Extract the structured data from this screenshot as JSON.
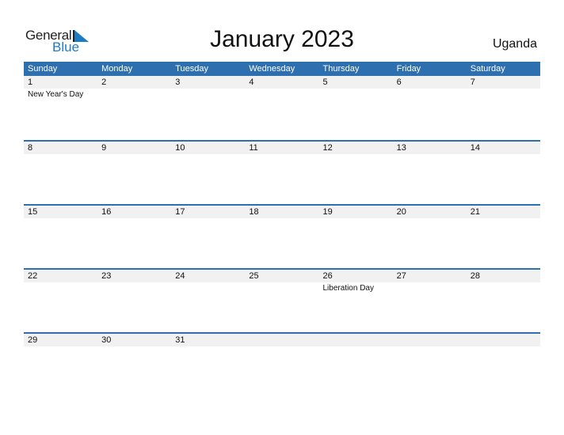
{
  "logo": {
    "general": "General",
    "blue": "Blue"
  },
  "title": "January 2023",
  "country": "Uganda",
  "colors": {
    "accent": "#2e6fb0",
    "brand_blue": "#1f7bc1",
    "row_bg": "#f1f1f1"
  },
  "weekdays": [
    "Sunday",
    "Monday",
    "Tuesday",
    "Wednesday",
    "Thursday",
    "Friday",
    "Saturday"
  ],
  "weeks": [
    {
      "days": [
        "1",
        "2",
        "3",
        "4",
        "5",
        "6",
        "7"
      ],
      "events": [
        "New Year's Day",
        "",
        "",
        "",
        "",
        "",
        ""
      ]
    },
    {
      "days": [
        "8",
        "9",
        "10",
        "11",
        "12",
        "13",
        "14"
      ],
      "events": [
        "",
        "",
        "",
        "",
        "",
        "",
        ""
      ]
    },
    {
      "days": [
        "15",
        "16",
        "17",
        "18",
        "19",
        "20",
        "21"
      ],
      "events": [
        "",
        "",
        "",
        "",
        "",
        "",
        ""
      ]
    },
    {
      "days": [
        "22",
        "23",
        "24",
        "25",
        "26",
        "27",
        "28"
      ],
      "events": [
        "",
        "",
        "",
        "",
        "Liberation Day",
        "",
        ""
      ]
    },
    {
      "days": [
        "29",
        "30",
        "31",
        "",
        "",
        "",
        ""
      ],
      "events": [
        "",
        "",
        "",
        "",
        "",
        "",
        ""
      ]
    }
  ]
}
